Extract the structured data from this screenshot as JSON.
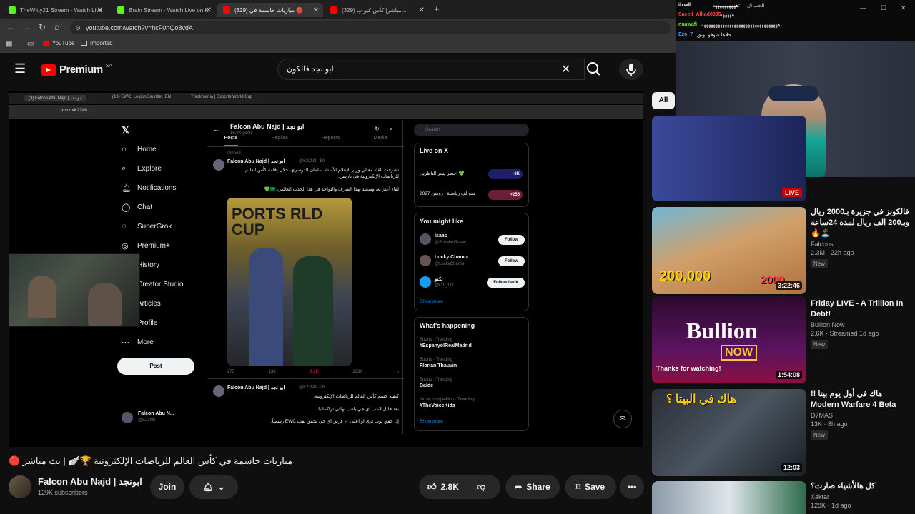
{
  "browser": {
    "tabs": [
      {
        "label": "TheWitty21 Stream - Watch Live",
        "color": "#53fc18"
      },
      {
        "label": "Brain Stream - Watch Live on K",
        "color": "#53fc18"
      },
      {
        "label": "مباريات حاسمة في (329) 🔴",
        "color": "#ff0000"
      },
      {
        "label": "(329) مباشر| كأس كيو ب...",
        "color": "#ff0000"
      }
    ],
    "new_tab": "+",
    "url": "youtube.com/watch?v=hcF0nQo8vdA",
    "bookmarks": [
      "YouTube",
      "Imported"
    ]
  },
  "youtube": {
    "logo": "Premium",
    "logo_sup": "SA",
    "search_value": "ابو نجد فالكون",
    "filter_chip": "All"
  },
  "stream_screen": {
    "tabs": [
      "(3) Falcon Abu Najd | ابو نجد",
      "(13) EWC_LegionGauntlet_EN",
      "Trackmania | Esports World Cup"
    ],
    "url": "x.com/K22N8",
    "nav": [
      "Home",
      "Explore",
      "Notifications",
      "Chat",
      "SuperGrok",
      "Premium+",
      "History",
      "Creator Studio",
      "Articles",
      "Profile",
      "More"
    ],
    "post_button": "Post",
    "profile_name": "Falcon Abu Najd | ابو نجد",
    "posts_count": "19.9K posts",
    "profile_tabs": [
      "Posts",
      "Replies",
      "Reposts",
      "Media"
    ],
    "pinned": "Pinned",
    "tweet1_author": "Falcon Abu Najd | ابو نجد",
    "tweet1_handle": "@K22N8 · 5h",
    "tweet1_text": "تشرفت بلقاء معالي وزير الإعلام الأستاذ سلمان الدوسري، خلال إقامة كأس العالم للرياضات الإلكترونية في باريس.",
    "tweet1_text2": "لقاء أعتز به، وسعيد بهذا الشرف والتواجد في هذا الحدث العالمي 🇸🇦💚",
    "tweet1_stats": [
      "273",
      "138",
      "2.2K",
      "123K"
    ],
    "photo_text": "PORTS RLD CUP",
    "tweet2_author": "Falcon Abu Najd | ابو نجد",
    "tweet2_handle": "@K22N8 · 2h",
    "tweet2_text": "كيفية حسم كأس العالم للرياضات الإلكترونية:",
    "tweet2_text2": "بعد قليل لاعب اي جي يلعب نهائي تراكمانيا.",
    "tweet2_text3": "إذا حقق توب ثري او اعلى ← فريق اي جي يحقق لقب EWC رسمياً.",
    "search_placeholder": "Search",
    "live_on_x": "Live on X",
    "live_items": [
      {
        "text": "احضر يسر الناظرين 💚",
        "badge": "+3K"
      },
      {
        "text": "سوالف رياضية | روشن 2027",
        "badge": "+255"
      }
    ],
    "you_might_like": "You might like",
    "suggest": [
      {
        "name": "Isaac",
        "handle": "@SceMan3saac",
        "btn": "Follow"
      },
      {
        "name": "Lucky Chamu",
        "handle": "@LuckyChamu",
        "btn": "Follow"
      },
      {
        "name": "تكنو",
        "handle": "@OT_111",
        "btn": "Follow back"
      }
    ],
    "show_more": "Show more",
    "whats_happening": "What's happening",
    "trends": [
      {
        "cat": "Sports · Trending",
        "name": "#EspanyolRealMadrid"
      },
      {
        "cat": "Sports · Trending",
        "name": "Florian Thauvin"
      },
      {
        "cat": "Sports · Trending",
        "name": "Balde"
      },
      {
        "cat": "Music competition · Trending",
        "name": "#TheVoiceKids"
      }
    ],
    "bottom_name": "Falcon Abu N...",
    "bottom_handle": "@K22N8"
  },
  "video": {
    "title": "مباريات حاسمة في كأس العالم للرياضات الإلكترونية 🏆🪽 | بث مباشر 🔴",
    "channel": "Falcon Abu Najd | ابونجد",
    "subscribers": "129K subscribers",
    "join": "Join",
    "likes": "2.8K",
    "share": "Share",
    "save": "Save"
  },
  "chat": [
    {
      "user": "ilxwll",
      "msg": ":ههههههههههه",
      "color": "#ffffff"
    },
    {
      "user": "Saeed_Alhad0395",
      "msg": "هههههه :",
      "color": "#ff4444"
    },
    {
      "user": "nnawafi",
      "msg": ":هههههههههههههههههههههههههههههههههه",
      "color": "#53fc18"
    },
    {
      "user": "Ezo_7",
      "msg": "خلاها شوفو بوتق :",
      "color": "#3da1ff"
    }
  ],
  "chat_top": "الحب ال",
  "recs": [
    {
      "title": "فالكونز في جزيرة بـ2000 ريال وبـ200 الف ريال لمدة 24ساعة 🏝️🔥",
      "channel": "Falcons",
      "meta": "2.3M · 22h ago",
      "badge": "New",
      "duration": "3:22:46",
      "thumb_text": "200,000",
      "thumb_text2": "2000"
    },
    {
      "title": "Friday LIVE - A Trillion In Debt!",
      "channel": "Bullion Now",
      "meta": "2.6K · Streamed 1d ago",
      "badge": "New",
      "duration": "1:54:08",
      "thumb_text": "Bullion",
      "thumb_text2": "NOW",
      "thumb_text3": "Thanks for watching!"
    },
    {
      "title": "هاك في أول يوم بيتا !! Modern Warfare 4 Beta",
      "channel": "D7MAS",
      "meta": "13K · 8h ago",
      "badge": "New",
      "duration": "12:03",
      "thumb_text": "هاك في البيتا ؟"
    },
    {
      "title": "كل هالأشياء صارت؟",
      "channel": "Xaktar",
      "meta": "128K · 1d ago"
    }
  ],
  "live_badge": "LIVE"
}
